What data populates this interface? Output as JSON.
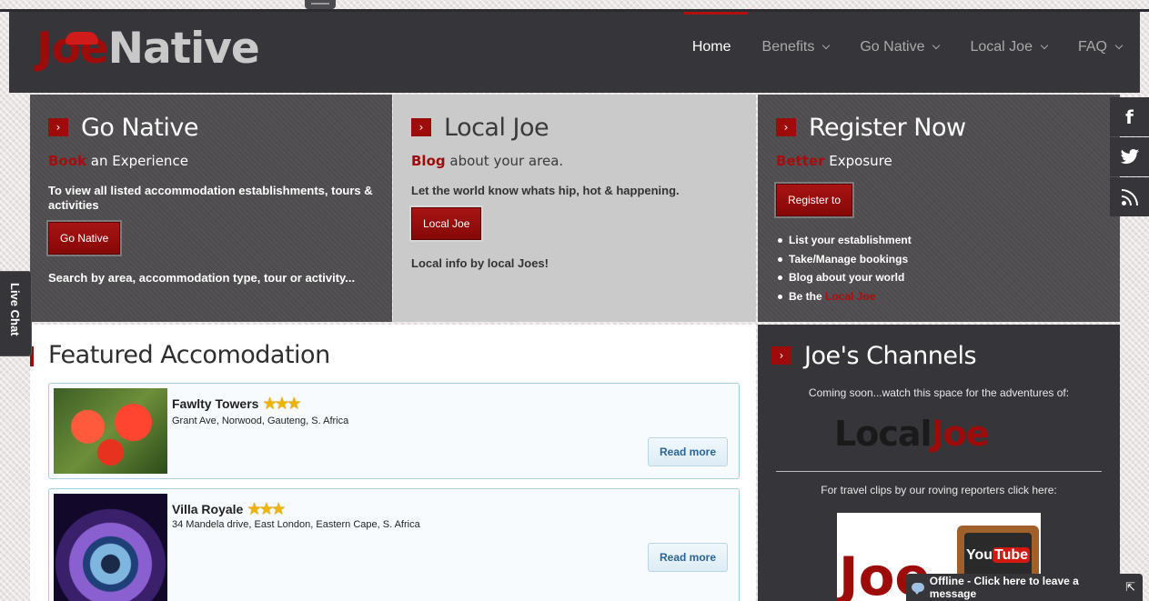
{
  "header": {
    "logo_joe": "Joe",
    "logo_native": "Native",
    "nav": [
      {
        "label": "Home",
        "active": true
      },
      {
        "label": "Benefits"
      },
      {
        "label": "Go Native"
      },
      {
        "label": "Local Joe"
      },
      {
        "label": "FAQ"
      }
    ]
  },
  "panels": {
    "go_native": {
      "title": "Go Native",
      "lead_red": "Book",
      "lead_rest": " an Experience",
      "text": "To view all listed accommodation establishments, tours & activities",
      "button": "Go Native",
      "footer": "Search by area, accommodation type, tour or activity..."
    },
    "local_joe": {
      "title": "Local Joe",
      "lead_red": "Blog",
      "lead_rest": " about your area.",
      "text": "Let the world know whats hip, hot & happening.",
      "button": "Local Joe",
      "footer": "Local info by local Joes!"
    },
    "register": {
      "title": "Register Now",
      "lead_red": "Better",
      "lead_rest": " Exposure",
      "button": "Register to",
      "bullets": [
        "List your establishment",
        "Take/Manage bookings",
        "Blog about your world"
      ],
      "last_bullet_prefix": "Be the ",
      "last_bullet_red": "Local Joe"
    }
  },
  "featured": {
    "title": "Featured Accomodation",
    "items": [
      {
        "name": "Fawlty Towers",
        "stars": "★★★",
        "address": "Grant Ave, Norwood, Gauteng, S. Africa",
        "read_more": "Read more"
      },
      {
        "name": "Villa Royale",
        "stars": "★★★",
        "address": "34 Mandela drive, East London, Eastern Cape, S. Africa",
        "read_more": "Read more"
      }
    ]
  },
  "channels": {
    "title": "Joe's Channels",
    "coming_soon": "Coming soon...watch this space for the adventures of:",
    "logo_local": "Local",
    "logo_joe": "Joe",
    "travel_clips": "For travel clips by our roving reporters click here:",
    "yt_joe": "Joe",
    "yt_you": "You",
    "yt_tube": "Tube"
  },
  "social": {
    "facebook": "f",
    "twitter": "twitter-icon",
    "rss": "rss-icon"
  },
  "live_chat": "Live Chat",
  "offline_bar": "Offline - Click here to leave a message",
  "colors": {
    "brand_red": "#9e0b0b",
    "header_bg": "#363539",
    "panel_dark": "#4d4b4d",
    "panel_light": "#cacaca"
  }
}
